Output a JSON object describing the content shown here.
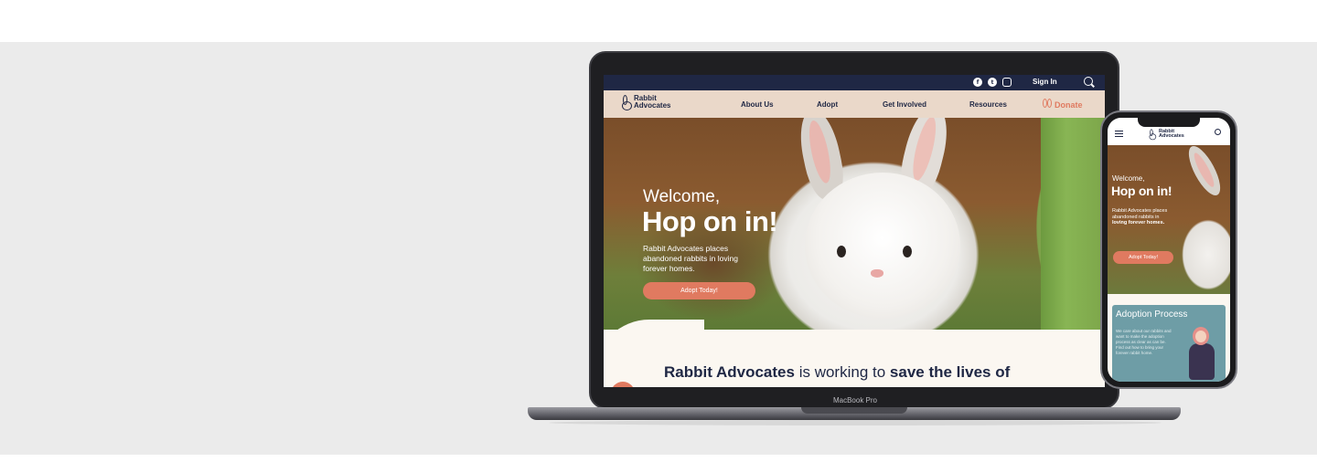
{
  "laptop": {
    "device_label": "MacBook Pro",
    "topbar": {
      "social_icons": [
        "facebook-icon",
        "twitter-icon",
        "instagram-icon"
      ],
      "sign_in": "Sign In",
      "search_icon": "search-icon"
    },
    "nav": {
      "logo_line1": "Rabbit",
      "logo_line2": "Advocates",
      "items": [
        "About Us",
        "Adopt",
        "Get Involved",
        "Resources"
      ],
      "donate": "Donate"
    },
    "hero": {
      "welcome": "Welcome,",
      "headline": "Hop on in!",
      "subtitle": "Rabbit Advocates places abandoned rabbits in loving forever homes.",
      "button": "Adopt Today!"
    },
    "tagline": {
      "part1": "Rabbit Advocates",
      "part2": " is working to ",
      "part3": "save the lives of"
    }
  },
  "phone": {
    "header": {
      "menu_icon": "hamburger-menu-icon",
      "logo_line1": "Rabbit",
      "logo_line2": "Advocates",
      "search_icon": "search-icon"
    },
    "hero": {
      "welcome": "Welcome,",
      "headline": "Hop on in!",
      "subtitle_plain": "Rabbit Advocates places abandoned rabbits in",
      "subtitle_bold": "loving forever homes.",
      "button": "Adopt Today!"
    },
    "card": {
      "title": "Adoption Process",
      "text": "We care about our rabbits and want to make the adoption process as clear as can be. Find out how to bring your forever rabbit home."
    }
  },
  "colors": {
    "navy": "#1f2744",
    "coral": "#e07a60",
    "nav_beige": "#ead8c9",
    "cream": "#fbf7f1",
    "teal_card": "#6e9da6",
    "background": "#ebebeb"
  }
}
